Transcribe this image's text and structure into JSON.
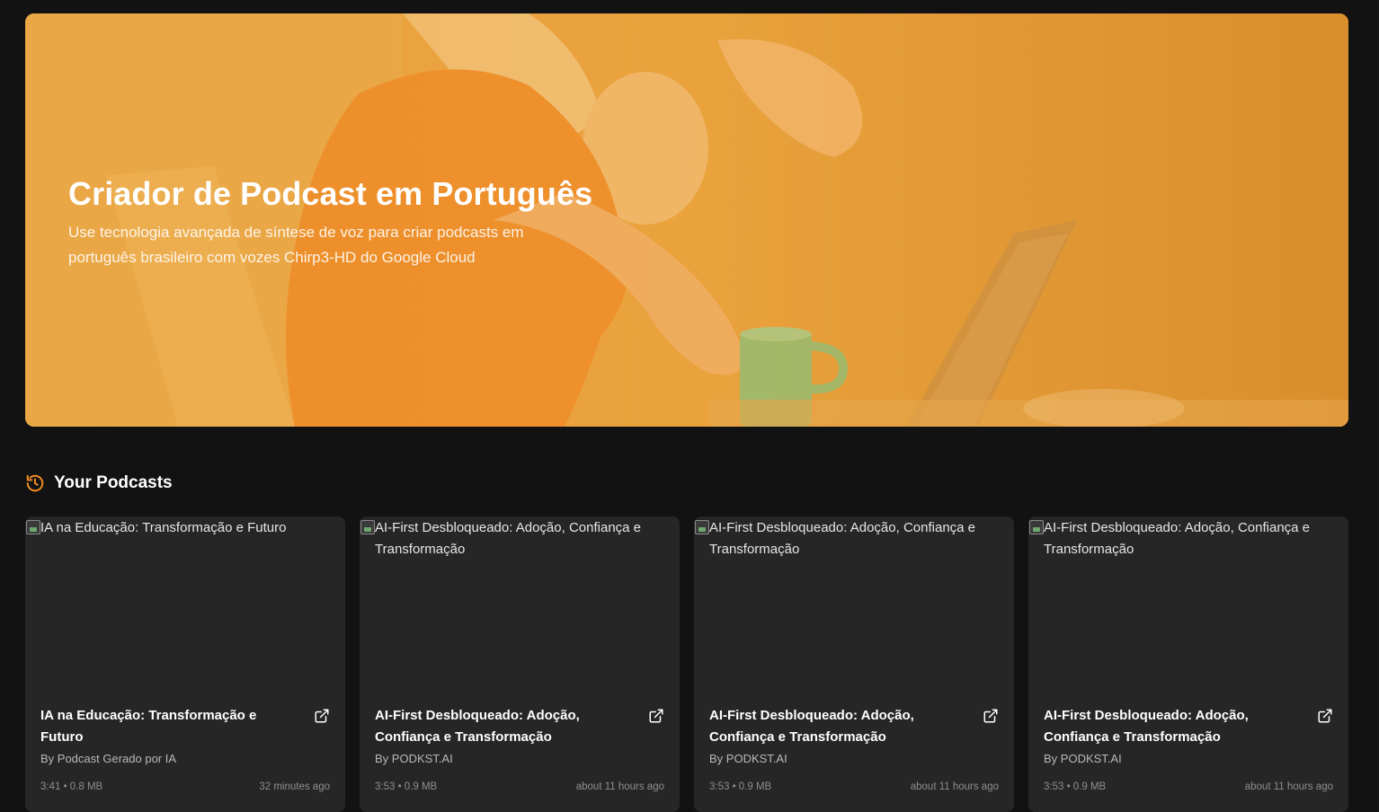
{
  "hero": {
    "title": "Criador de Podcast em Português",
    "subtitle": "Use tecnologia avançada de síntese de voz para criar podcasts em português brasileiro com vozes Chirp3-HD do Google Cloud"
  },
  "section": {
    "icon": "history-icon",
    "title": "Your Podcasts"
  },
  "colors": {
    "accent": "#f08a24",
    "background": "#121212",
    "card": "#262626"
  },
  "podcasts": [
    {
      "image_alt": "IA na Educação: Transformação e Futuro",
      "title": "IA na Educação: Transformação e Futuro",
      "author": "By Podcast Gerado por IA",
      "meta": "3:41 • 0.8 MB",
      "time": "32 minutes ago"
    },
    {
      "image_alt": "AI-First Desbloqueado: Adoção, Confiança e Transformação",
      "title": "AI-First Desbloqueado: Adoção, Confiança e Transformação",
      "author": "By PODKST.AI",
      "meta": "3:53 • 0.9 MB",
      "time": "about 11 hours ago"
    },
    {
      "image_alt": "AI-First Desbloqueado: Adoção, Confiança e Transformação",
      "title": "AI-First Desbloqueado: Adoção, Confiança e Transformação",
      "author": "By PODKST.AI",
      "meta": "3:53 • 0.9 MB",
      "time": "about 11 hours ago"
    },
    {
      "image_alt": "AI-First Desbloqueado: Adoção, Confiança e Transformação",
      "title": "AI-First Desbloqueado: Adoção, Confiança e Transformação",
      "author": "By PODKST.AI",
      "meta": "3:53 • 0.9 MB",
      "time": "about 11 hours ago"
    }
  ]
}
